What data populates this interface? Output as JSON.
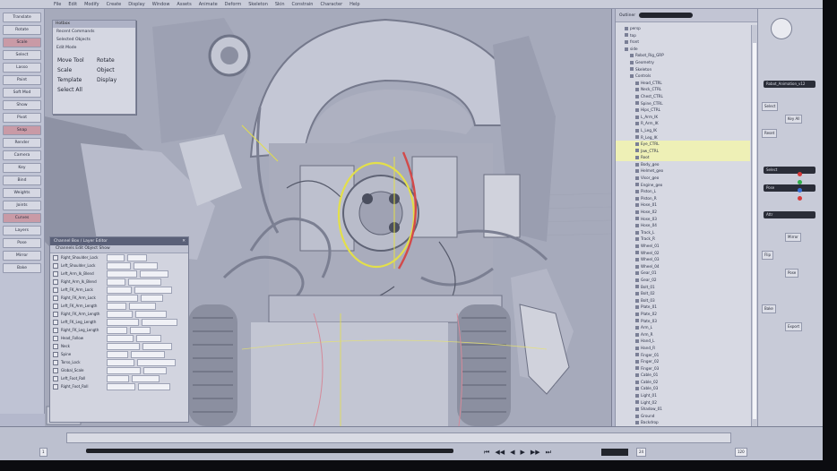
{
  "menubar": [
    "File",
    "Edit",
    "Modify",
    "Create",
    "Display",
    "Window",
    "Assets",
    "Animate",
    "Deform",
    "Skeleton",
    "Skin",
    "Constrain",
    "Character",
    "Help"
  ],
  "shelf": [
    "Translate",
    "Rotate",
    "Scale",
    "Select",
    "Lasso",
    "Paint",
    "Soft Mod",
    "Show",
    "Pivot",
    "Snap",
    "Render",
    "Camera",
    "Key",
    "Bind",
    "Weights",
    "Joints",
    "Curves",
    "Layers",
    "Pose",
    "Mirror",
    "Bake"
  ],
  "float_menu": {
    "title": "Hotbox",
    "items": [
      "Recent Commands",
      "Selected Objects",
      "Edit Mode",
      "Move Tool",
      "Rotate",
      "Scale",
      "Object",
      "Template",
      "Display",
      "Select All"
    ]
  },
  "channel_box": {
    "title": "Channel Box / Layer Editor",
    "toolbar": "Channels  Edit  Object  Show",
    "attributes": [
      "Right_Shoulder_Lock",
      "Left_Shoulder_Lock",
      "Left_Arm_Ik_Blend",
      "Right_Arm_Ik_Blend",
      "Left_FK_Arm_Lock",
      "Right_FK_Arm_Lock",
      "Left_FK_Arm_Length",
      "Right_FK_Arm_Length",
      "Left_FK_Leg_Length",
      "Right_FK_Leg_Length",
      "Head_Follow",
      "Neck",
      "Spine",
      "Torso_Lock",
      "Global_Scale",
      "Left_Foot_Roll",
      "Right_Foot_Roll"
    ]
  },
  "outliner": {
    "title": "Outliner",
    "rows": [
      "persp",
      "top",
      "front",
      "side",
      "Robot_Rig_GRP",
      "Geometry",
      "Skeleton",
      "Controls",
      "Head_CTRL",
      "Neck_CTRL",
      "Chest_CTRL",
      "Spine_CTRL",
      "Hips_CTRL",
      "L_Arm_IK",
      "R_Arm_IK",
      "L_Leg_IK",
      "R_Leg_IK",
      "Eye_CTRL",
      "Jaw_CTRL",
      "Root",
      "Body_geo",
      "Helmet_geo",
      "Visor_geo",
      "Engine_geo",
      "Piston_L",
      "Piston_R",
      "Hose_01",
      "Hose_02",
      "Hose_03",
      "Hose_04",
      "Track_L",
      "Track_R",
      "Wheel_01",
      "Wheel_02",
      "Wheel_03",
      "Wheel_04",
      "Gear_01",
      "Gear_02",
      "Bolt_01",
      "Bolt_02",
      "Bolt_03",
      "Plate_01",
      "Plate_02",
      "Plate_03",
      "Arm_L",
      "Arm_R",
      "Hand_L",
      "Hand_R",
      "Finger_01",
      "Finger_02",
      "Finger_03",
      "Cable_01",
      "Cable_02",
      "Cable_03",
      "Light_01",
      "Light_02",
      "Shadow_01",
      "Ground",
      "Backdrop",
      "defaultLightSet",
      "defaultObjectSet"
    ],
    "selected_rows": [
      17,
      18,
      19
    ]
  },
  "attribute_panel": {
    "buttons": [
      "Select",
      "Key All",
      "Reset",
      "Mirror",
      "Flip",
      "Pose",
      "Bake",
      "Export"
    ],
    "dark_fields": [
      "Robot_Animation_v12",
      "Select",
      "Pose",
      "Attr"
    ],
    "status_colors": [
      "#d83a3a",
      "#2fae4a",
      "#3a6fd8",
      "#d83a3a"
    ]
  },
  "timeline": {
    "play_buttons": [
      "⏮",
      "◀◀",
      "◀",
      "▶",
      "▶▶",
      "⏭"
    ],
    "start_field": "1",
    "end_field": "120",
    "current_field": "24"
  },
  "colors": {
    "screen_bg": "#b4b8cc",
    "viewport_bg": "#a6aabb",
    "manipulator_yellow": "#e3df4a",
    "manipulator_red": "#d24a4a",
    "selection_highlight": "#eef0b6"
  }
}
